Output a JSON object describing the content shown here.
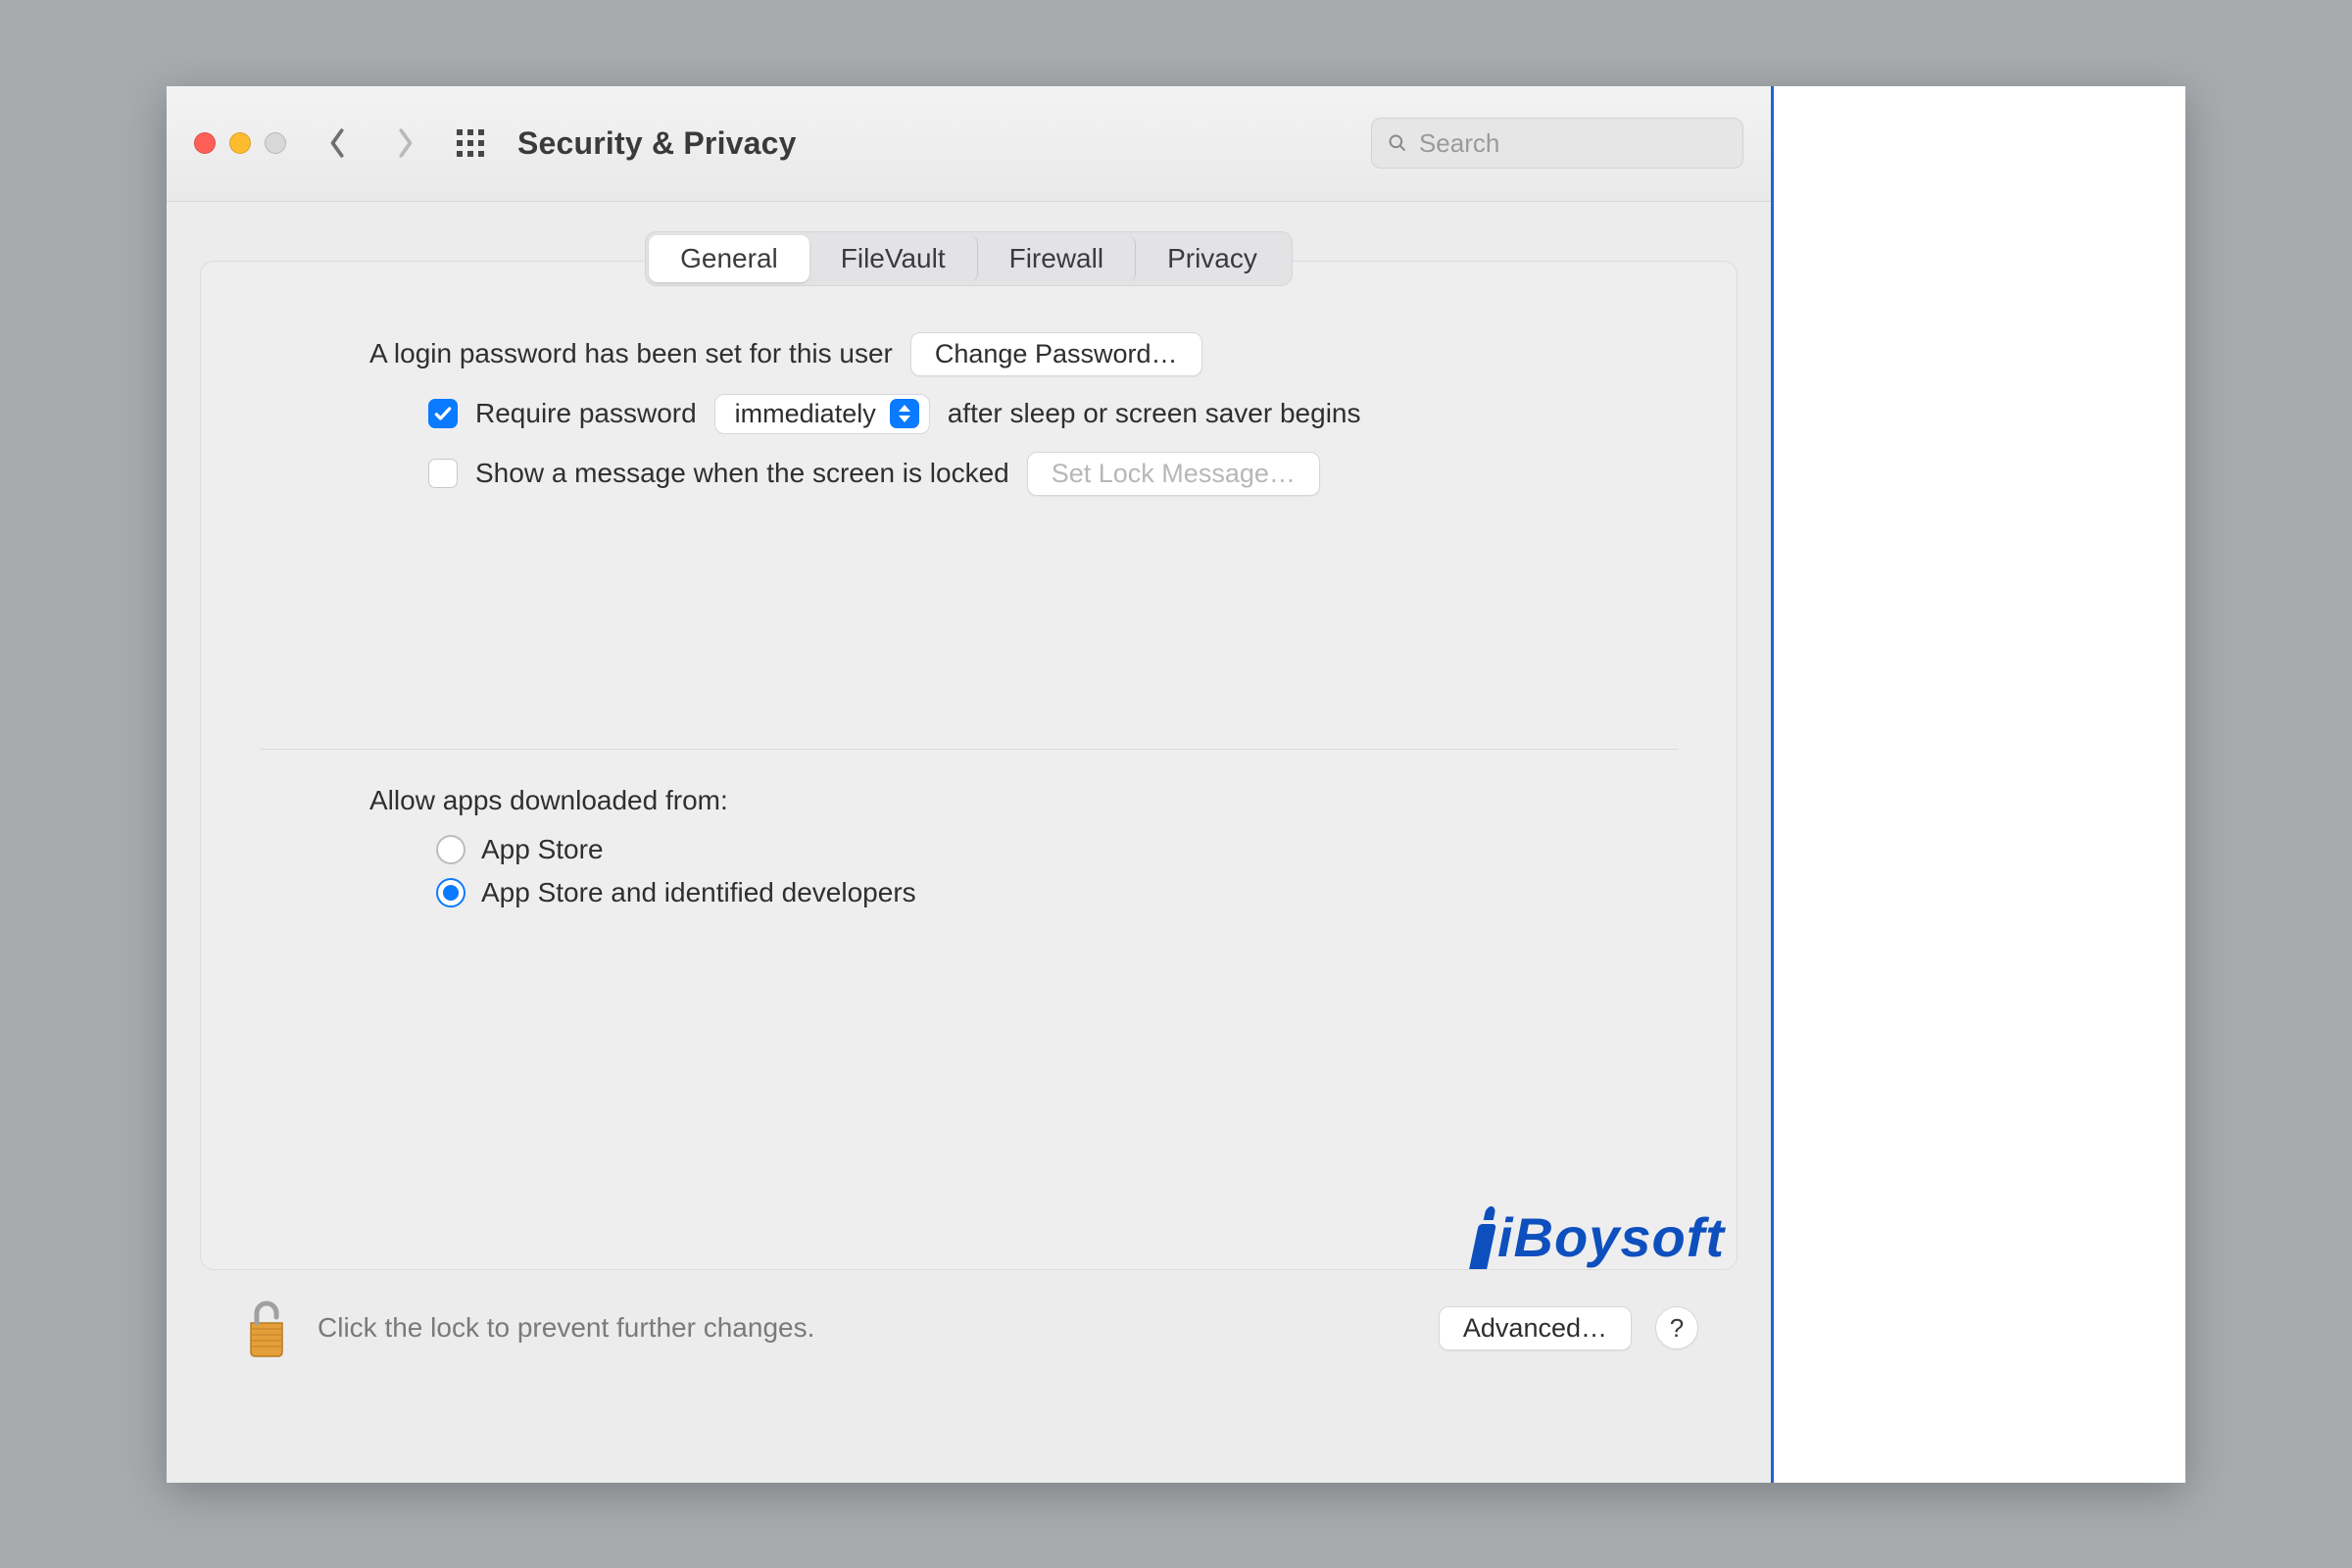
{
  "toolbar": {
    "title": "Security & Privacy",
    "search_placeholder": "Search"
  },
  "tabs": [
    "General",
    "FileVault",
    "Firewall",
    "Privacy"
  ],
  "selected_tab_index": 0,
  "general": {
    "login_password_text": "A login password has been set for this user",
    "change_password_label": "Change Password…",
    "require_password_checked": true,
    "require_password_prefix": "Require password",
    "require_password_select": "immediately",
    "require_password_suffix": "after sleep or screen saver begins",
    "show_message_checked": false,
    "show_message_label": "Show a message when the screen is locked",
    "set_lock_message_label": "Set Lock Message…",
    "allow_apps_label": "Allow apps downloaded from:",
    "allow_apps_options": [
      "App Store",
      "App Store and identified developers"
    ],
    "allow_apps_selected_index": 1
  },
  "footer": {
    "lock_text": "Click the lock to prevent further changes.",
    "advanced_label": "Advanced…",
    "help_label": "?"
  },
  "watermark": "iBoysoft"
}
